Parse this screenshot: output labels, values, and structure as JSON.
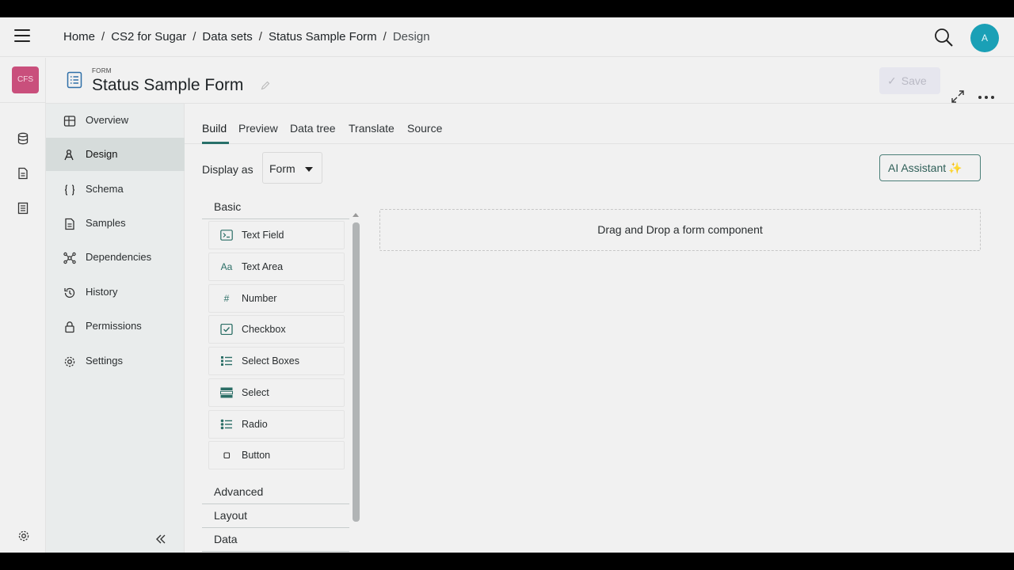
{
  "breadcrumb": {
    "items": [
      "Home",
      "CS2 for Sugar",
      "Data sets",
      "Status Sample Form"
    ],
    "current": "Design",
    "separator": "/"
  },
  "user": {
    "avatar_initial": "A"
  },
  "rail": {
    "org_badge": "CFS"
  },
  "form": {
    "type_label": "FORM",
    "title": "Status Sample Form"
  },
  "toolbar": {
    "save_label": "Save"
  },
  "sidenav": {
    "items": [
      {
        "label": "Overview",
        "icon": "table-icon"
      },
      {
        "label": "Design",
        "icon": "design-icon",
        "active": true
      },
      {
        "label": "Schema",
        "icon": "braces-icon"
      },
      {
        "label": "Samples",
        "icon": "document-icon"
      },
      {
        "label": "Dependencies",
        "icon": "network-icon"
      },
      {
        "label": "History",
        "icon": "history-icon"
      },
      {
        "label": "Permissions",
        "icon": "lock-icon"
      },
      {
        "label": "Settings",
        "icon": "gear-icon"
      }
    ]
  },
  "tabs": [
    "Build",
    "Preview",
    "Data tree",
    "Translate",
    "Source"
  ],
  "display": {
    "label": "Display as",
    "value": "Form"
  },
  "ai_button": {
    "label": "AI Assistant"
  },
  "palette": {
    "groups": {
      "basic": "Basic",
      "advanced": "Advanced",
      "layout": "Layout",
      "data": "Data"
    },
    "basic_components": [
      {
        "label": "Text Field",
        "icon": "terminal-icon"
      },
      {
        "label": "Text Area",
        "icon": "font-icon"
      },
      {
        "label": "Number",
        "icon": "hash-icon"
      },
      {
        "label": "Checkbox",
        "icon": "checkbox-icon"
      },
      {
        "label": "Select Boxes",
        "icon": "list-icon"
      },
      {
        "label": "Select",
        "icon": "select-icon"
      },
      {
        "label": "Radio",
        "icon": "radio-list-icon"
      },
      {
        "label": "Button",
        "icon": "square-icon"
      }
    ]
  },
  "dropzone": {
    "text": "Drag and Drop a form component"
  },
  "colors": {
    "accent": "#28706a",
    "avatar": "#1aa0b6",
    "org_badge": "#c94f7c"
  }
}
